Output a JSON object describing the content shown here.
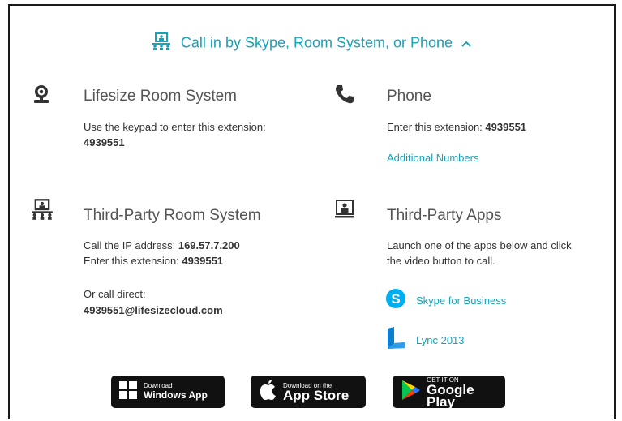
{
  "header": {
    "title": "Call in by Skype, Room System, or Phone"
  },
  "room_system": {
    "title": "Lifesize Room System",
    "instruction": "Use the keypad to enter this extension:",
    "extension": "4939551"
  },
  "phone": {
    "title": "Phone",
    "instruction": "Enter this extension:",
    "extension": "4939551",
    "additional_numbers_link": "Additional Numbers"
  },
  "third_party_room": {
    "title": "Third-Party Room System",
    "ip_label": "Call the IP address:",
    "ip_value": "169.57.7.200",
    "ext_label": "Enter this extension:",
    "ext_value": "4939551",
    "direct_label": "Or call direct:",
    "direct_value": "4939551@lifesizecloud.com"
  },
  "third_party_apps": {
    "title": "Third-Party Apps",
    "instruction_line1": "Launch one of the apps below and click",
    "instruction_line2": "the video button to call.",
    "apps": [
      {
        "label": "Skype for Business",
        "icon": "skype-icon",
        "color": "#00aff0"
      },
      {
        "label": "Lync 2013",
        "icon": "lync-icon",
        "color": "#0a7fd1"
      }
    ]
  },
  "stores": [
    {
      "small": "Download",
      "big": "Windows App",
      "icon": "windows-icon"
    },
    {
      "small": "Download on the",
      "big": "App Store",
      "icon": "apple-icon"
    },
    {
      "small": "GET IT ON",
      "big": "Google Play",
      "icon": "google-play-icon"
    }
  ],
  "colors": {
    "accent": "#17a2b8",
    "text": "#333333",
    "store_bg": "#111111"
  }
}
